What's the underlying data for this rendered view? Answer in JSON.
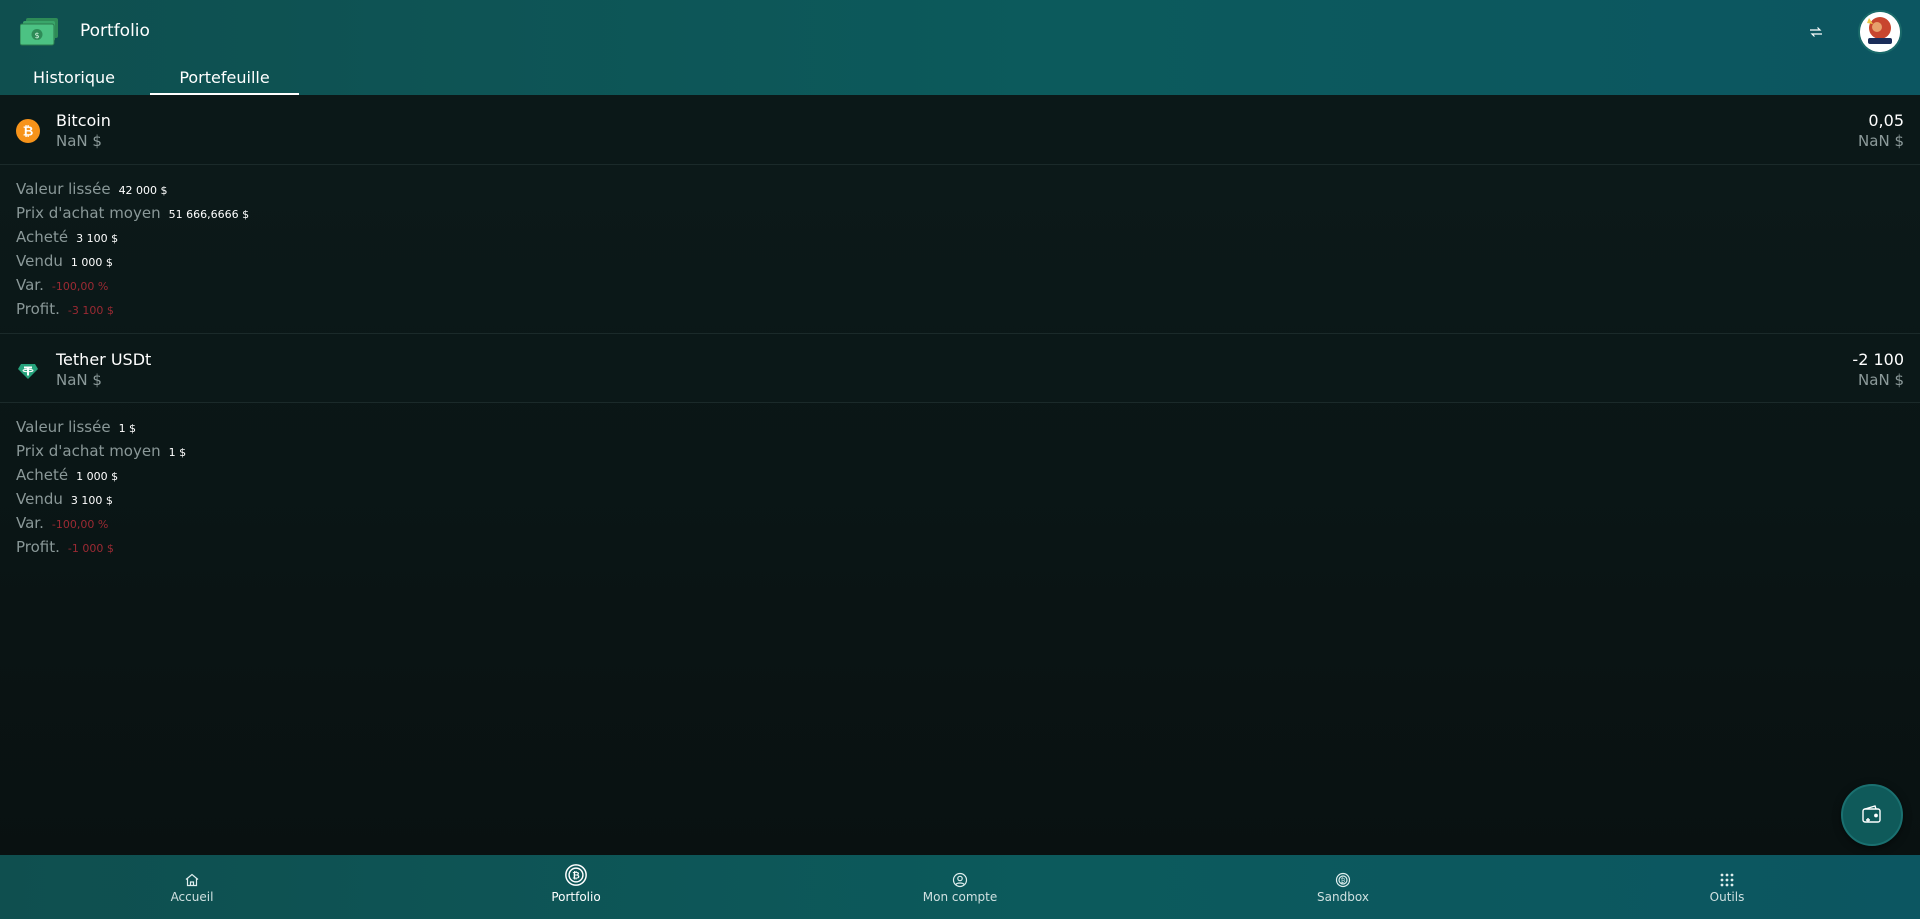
{
  "header": {
    "title": "Portfolio",
    "tabs": [
      {
        "label": "Historique",
        "active": false
      },
      {
        "label": "Portefeuille",
        "active": true
      }
    ]
  },
  "assets": [
    {
      "name": "Bitcoin",
      "icon": "bitcoin-icon",
      "value": "NaN $",
      "quantity": "0,05",
      "quantity_value": "NaN $",
      "details": {
        "smoothed_label": "Valeur lissée",
        "smoothed": "42 000 $",
        "avg_price_label": "Prix d'achat moyen",
        "avg_price": "51 666,6666 $",
        "bought_label": "Acheté",
        "bought": "3 100 $",
        "sold_label": "Vendu",
        "sold": "1 000 $",
        "var_label": "Var.",
        "var": "-100,00 %",
        "profit_label": "Profit.",
        "profit": "-3 100 $"
      }
    },
    {
      "name": "Tether USDt",
      "icon": "tether-icon",
      "value": "NaN $",
      "quantity": "-2 100",
      "quantity_value": "NaN $",
      "details": {
        "smoothed_label": "Valeur lissée",
        "smoothed": "1 $",
        "avg_price_label": "Prix d'achat moyen",
        "avg_price": "1 $",
        "bought_label": "Acheté",
        "bought": "1 000 $",
        "sold_label": "Vendu",
        "sold": "3 100 $",
        "var_label": "Var.",
        "var": "-100,00 %",
        "profit_label": "Profit.",
        "profit": "-1 000 $"
      }
    }
  ],
  "bottom_nav": [
    {
      "label": "Accueil",
      "icon": "home-icon",
      "active": false
    },
    {
      "label": "Portfolio",
      "icon": "portfolio-coin-icon",
      "active": true
    },
    {
      "label": "Mon compte",
      "icon": "user-circle-icon",
      "active": false
    },
    {
      "label": "Sandbox",
      "icon": "sandbox-coin-icon",
      "active": false
    },
    {
      "label": "Outils",
      "icon": "grid-icon",
      "active": false
    }
  ],
  "colors": {
    "accent": "#0c5a5c",
    "background": "#0a1414",
    "negative": "#9b2a33",
    "bitcoin": "#f7931a",
    "tether": "#26a17b"
  }
}
